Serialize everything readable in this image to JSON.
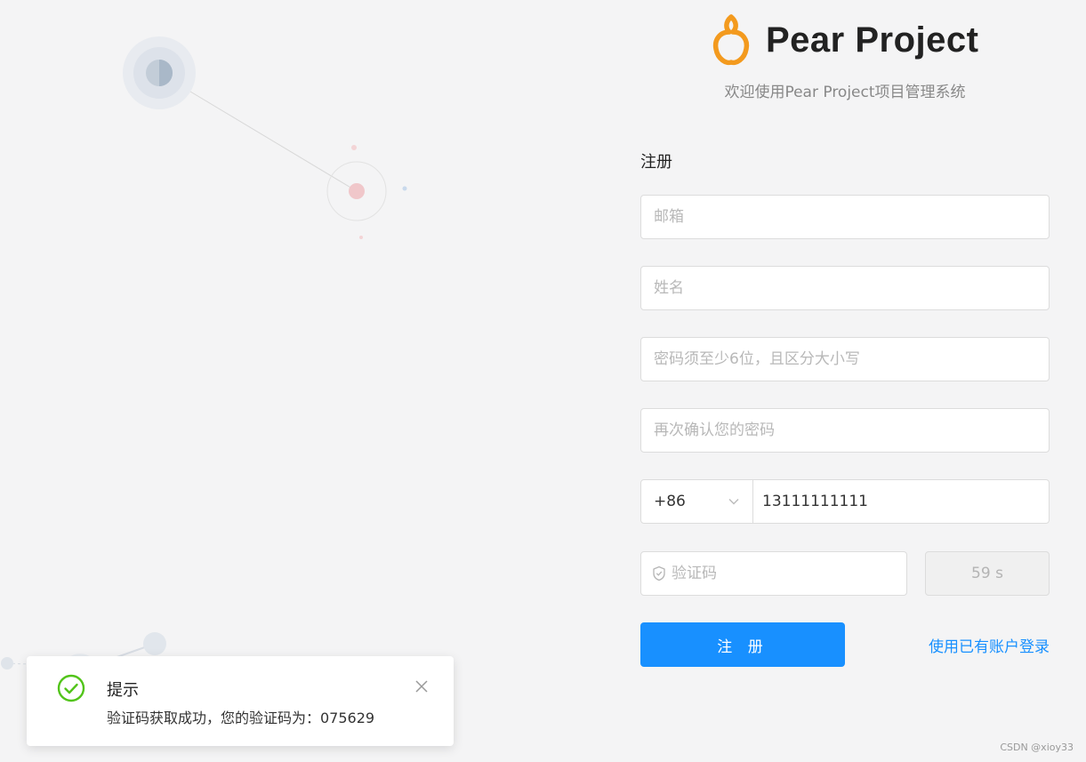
{
  "header": {
    "brand_name": "Pear Project",
    "welcome": "欢迎使用Pear Project项目管理系统"
  },
  "form": {
    "title": "注册",
    "email_placeholder": "邮箱",
    "name_placeholder": "姓名",
    "password_placeholder": "密码须至少6位，且区分大小写",
    "confirm_placeholder": "再次确认您的密码",
    "country_code": "+86",
    "phone_value": "13111111111",
    "code_placeholder": "验证码",
    "countdown": "59 s",
    "submit_label": "注 册",
    "login_link": "使用已有账户登录"
  },
  "notification": {
    "title": "提示",
    "message": "验证码获取成功，您的验证码为：075629"
  },
  "watermark": "CSDN @xioy33",
  "colors": {
    "primary": "#1890ff",
    "success": "#52c41a",
    "logo_orange": "#f39a1e"
  },
  "icons": {
    "logo": "pear-logo-icon",
    "dropdown": "chevron-down-icon",
    "code": "shield-check-icon",
    "success": "check-circle-icon",
    "close": "close-icon"
  }
}
